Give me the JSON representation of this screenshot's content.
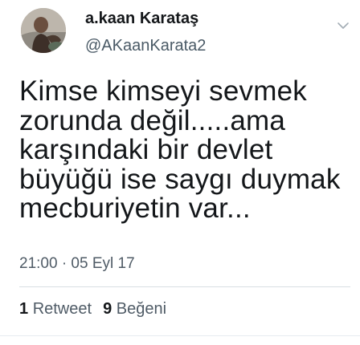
{
  "author": {
    "display_name": "a.kaan Karataş",
    "handle": "@AKaanKarata2",
    "avatar": "user-avatar-photo"
  },
  "menu": {
    "icon": "chevron-down-icon"
  },
  "tweet": {
    "lines": [
      "Kimse kimseyi sevmek",
      "zorunda değil.....ama",
      "karşındaki bir devlet",
      "büyüğü ise saygı duymak",
      "mecburiyetin var..."
    ],
    "timestamp": "21:00 · 05 Eyl 17"
  },
  "stats": {
    "retweets": {
      "count": "1",
      "label": "Retweet"
    },
    "likes": {
      "count": "9",
      "label": "Beğeni"
    }
  }
}
